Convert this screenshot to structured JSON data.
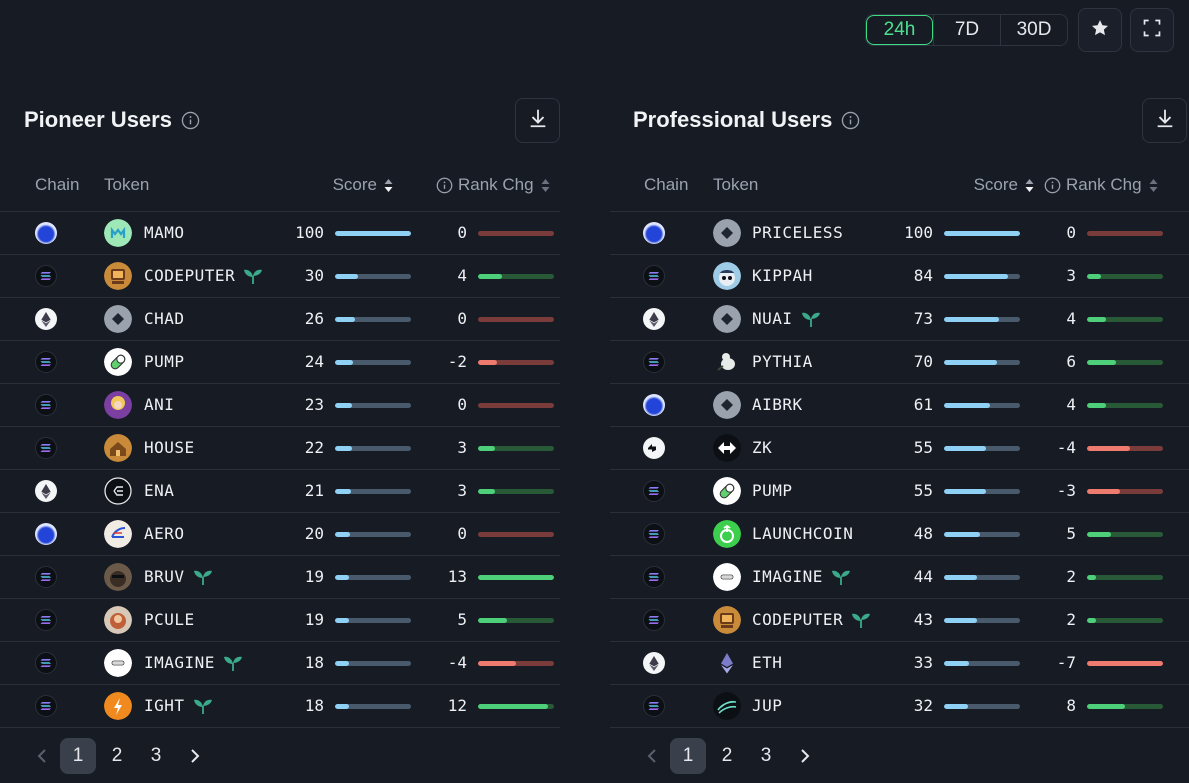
{
  "timeframes": [
    {
      "label": "24h",
      "active": true
    },
    {
      "label": "7D",
      "active": false
    },
    {
      "label": "30D",
      "active": false
    }
  ],
  "panels": [
    {
      "title": "Pioneer Users",
      "headers": {
        "chain": "Chain",
        "token": "Token",
        "score": "Score",
        "rank": "Rank Chg"
      },
      "rows": [
        {
          "chain": "base",
          "token": "MAMO",
          "sprout": false,
          "score": "100",
          "score_pct": 1.0,
          "rank": "0",
          "rank_pct": 0,
          "dir": "zero",
          "icon": "mamo",
          "color": "#8fe0b0"
        },
        {
          "chain": "sol",
          "token": "CODEPUTER",
          "sprout": true,
          "score": "30",
          "score_pct": 0.3,
          "rank": "4",
          "rank_pct": 0.31,
          "dir": "pos",
          "icon": "codeputer",
          "color": "#c98a3a"
        },
        {
          "chain": "eth",
          "token": "CHAD",
          "sprout": false,
          "score": "26",
          "score_pct": 0.26,
          "rank": "0",
          "rank_pct": 0,
          "dir": "zero",
          "icon": "diamond",
          "color": "#9aa2ae"
        },
        {
          "chain": "sol",
          "token": "PUMP",
          "sprout": false,
          "score": "24",
          "score_pct": 0.24,
          "rank": "-2",
          "rank_pct": 0.25,
          "dir": "neg",
          "icon": "pill",
          "color": "#ffffff"
        },
        {
          "chain": "sol",
          "token": "ANI",
          "sprout": false,
          "score": "23",
          "score_pct": 0.23,
          "rank": "0",
          "rank_pct": 0,
          "dir": "zero",
          "icon": "ani",
          "color": "#d9a84a"
        },
        {
          "chain": "sol",
          "token": "HOUSE",
          "sprout": false,
          "score": "22",
          "score_pct": 0.22,
          "rank": "3",
          "rank_pct": 0.23,
          "dir": "pos",
          "icon": "house",
          "color": "#c98a3a"
        },
        {
          "chain": "eth",
          "token": "ENA",
          "sprout": false,
          "score": "21",
          "score_pct": 0.21,
          "rank": "3",
          "rank_pct": 0.23,
          "dir": "pos",
          "icon": "ena",
          "color": "#0c0f14"
        },
        {
          "chain": "base",
          "token": "AERO",
          "sprout": false,
          "score": "20",
          "score_pct": 0.2,
          "rank": "0",
          "rank_pct": 0,
          "dir": "zero",
          "icon": "aero",
          "color": "#f0ece4"
        },
        {
          "chain": "sol",
          "token": "BRUV",
          "sprout": true,
          "score": "19",
          "score_pct": 0.19,
          "rank": "13",
          "rank_pct": 1.0,
          "dir": "pos",
          "icon": "bruv",
          "color": "#6b5a48"
        },
        {
          "chain": "sol",
          "token": "PCULE",
          "sprout": false,
          "score": "19",
          "score_pct": 0.19,
          "rank": "5",
          "rank_pct": 0.38,
          "dir": "pos",
          "icon": "pcule",
          "color": "#c88a74"
        },
        {
          "chain": "sol",
          "token": "IMAGINE",
          "sprout": true,
          "score": "18",
          "score_pct": 0.18,
          "rank": "-4",
          "rank_pct": 0.5,
          "dir": "neg",
          "icon": "imagine",
          "color": "#ffffff"
        },
        {
          "chain": "sol",
          "token": "IGHT",
          "sprout": true,
          "score": "18",
          "score_pct": 0.18,
          "rank": "12",
          "rank_pct": 0.92,
          "dir": "pos",
          "icon": "ight",
          "color": "#f08a1f"
        }
      ],
      "pages": [
        "1",
        "2",
        "3"
      ]
    },
    {
      "title": "Professional Users",
      "headers": {
        "chain": "Chain",
        "token": "Token",
        "score": "Score",
        "rank": "Rank Chg"
      },
      "rows": [
        {
          "chain": "base",
          "token": "PRICELESS",
          "sprout": false,
          "score": "100",
          "score_pct": 1.0,
          "rank": "0",
          "rank_pct": 0,
          "dir": "zero",
          "icon": "diamond",
          "color": "#9aa2ae"
        },
        {
          "chain": "sol",
          "token": "KIPPAH",
          "sprout": false,
          "score": "84",
          "score_pct": 0.84,
          "rank": "3",
          "rank_pct": 0.18,
          "dir": "pos",
          "icon": "kippah",
          "color": "#9ecbe6"
        },
        {
          "chain": "eth",
          "token": "NUAI",
          "sprout": true,
          "score": "73",
          "score_pct": 0.73,
          "rank": "4",
          "rank_pct": 0.25,
          "dir": "pos",
          "icon": "diamond",
          "color": "#9aa2ae"
        },
        {
          "chain": "sol",
          "token": "PYTHIA",
          "sprout": false,
          "score": "70",
          "score_pct": 0.7,
          "rank": "6",
          "rank_pct": 0.38,
          "dir": "pos",
          "icon": "pythia",
          "color": "#e8ece8"
        },
        {
          "chain": "base",
          "token": "AIBRK",
          "sprout": false,
          "score": "61",
          "score_pct": 0.61,
          "rank": "4",
          "rank_pct": 0.25,
          "dir": "pos",
          "icon": "diamond",
          "color": "#9aa2ae"
        },
        {
          "chain": "zk",
          "token": "ZK",
          "sprout": false,
          "score": "55",
          "score_pct": 0.55,
          "rank": "-4",
          "rank_pct": 0.57,
          "dir": "neg",
          "icon": "zk",
          "color": "#0c0f14"
        },
        {
          "chain": "sol",
          "token": "PUMP",
          "sprout": false,
          "score": "55",
          "score_pct": 0.55,
          "rank": "-3",
          "rank_pct": 0.43,
          "dir": "neg",
          "icon": "pill",
          "color": "#ffffff"
        },
        {
          "chain": "sol",
          "token": "LAUNCHCOIN",
          "sprout": false,
          "score": "48",
          "score_pct": 0.48,
          "rank": "5",
          "rank_pct": 0.31,
          "dir": "pos",
          "icon": "launch",
          "color": "#3ccf4e"
        },
        {
          "chain": "sol",
          "token": "IMAGINE",
          "sprout": true,
          "score": "44",
          "score_pct": 0.44,
          "rank": "2",
          "rank_pct": 0.12,
          "dir": "pos",
          "icon": "imagine",
          "color": "#ffffff"
        },
        {
          "chain": "sol",
          "token": "CODEPUTER",
          "sprout": true,
          "score": "43",
          "score_pct": 0.43,
          "rank": "2",
          "rank_pct": 0.12,
          "dir": "pos",
          "icon": "codeputer",
          "color": "#c98a3a"
        },
        {
          "chain": "eth",
          "token": "ETH",
          "sprout": false,
          "score": "33",
          "score_pct": 0.33,
          "rank": "-7",
          "rank_pct": 1.0,
          "dir": "neg",
          "icon": "eth",
          "color": "#161b24"
        },
        {
          "chain": "sol",
          "token": "JUP",
          "sprout": false,
          "score": "32",
          "score_pct": 0.32,
          "rank": "8",
          "rank_pct": 0.5,
          "dir": "pos",
          "icon": "jup",
          "color": "#0c0f14"
        }
      ],
      "pages": [
        "1",
        "2",
        "3"
      ]
    }
  ]
}
